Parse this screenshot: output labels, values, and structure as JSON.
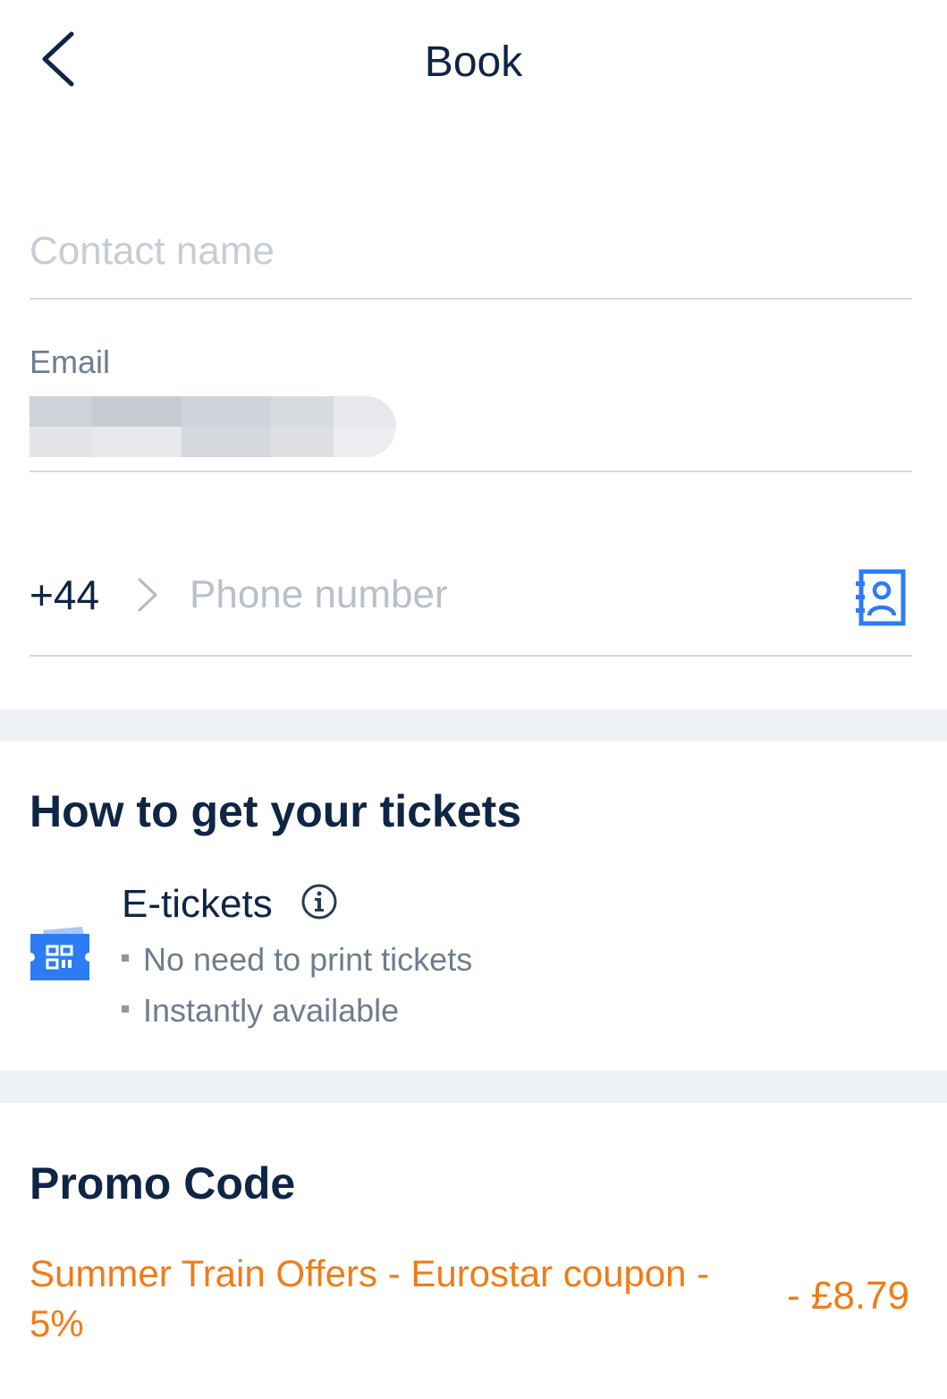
{
  "header": {
    "title": "Book",
    "back_icon": "chevron-left-icon"
  },
  "contact": {
    "name_placeholder": "Contact name",
    "name_value": "",
    "email_label": "Email",
    "email_value_redacted": true
  },
  "phone": {
    "country_code": "+44",
    "placeholder": "Phone number",
    "value": "",
    "contacts_icon": "address-book-icon"
  },
  "tickets": {
    "title": "How to get your tickets",
    "option_label": "E-tickets",
    "option_icon": "ticket-icon",
    "info_icon": "info-icon",
    "bullets": [
      "No need to print tickets",
      "Instantly available"
    ]
  },
  "promo": {
    "title": "Promo Code",
    "description": "Summer Train Offers - Eurostar coupon - 5%",
    "amount": "- £8.79"
  },
  "colors": {
    "text_primary": "#0f2545",
    "text_secondary": "#6f7d8e",
    "accent_blue": "#2d7cf6",
    "promo_orange": "#f07c18",
    "separator": "#eef1f5"
  }
}
